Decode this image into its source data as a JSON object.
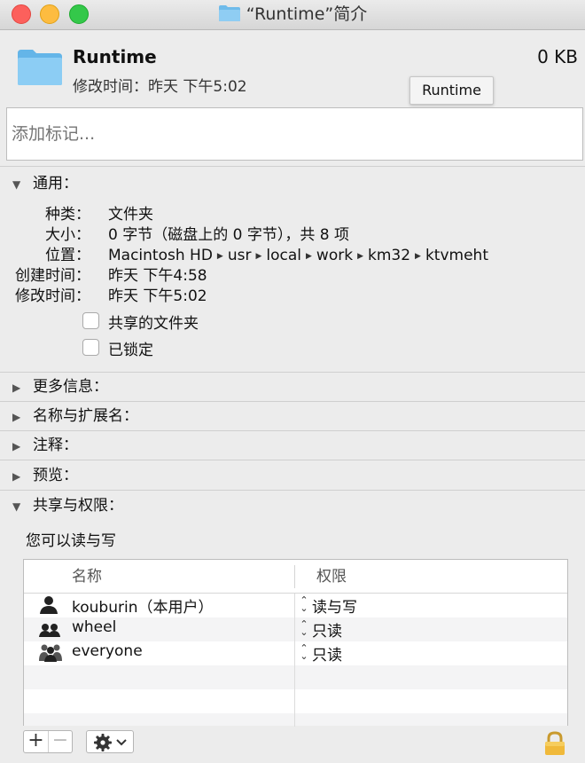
{
  "window": {
    "title": "“Runtime”简介"
  },
  "header": {
    "name": "Runtime",
    "size": "0 KB",
    "modified": "修改时间：昨天 下午5:02",
    "tooltip": "Runtime"
  },
  "tags": {
    "placeholder": "添加标记..."
  },
  "general": {
    "heading": "通用：",
    "kind_label": "种类：",
    "kind_value": "文件夹",
    "size_label": "大小：",
    "size_value": "0 字节（磁盘上的 0 字节），共 8 项",
    "where_label": "位置：",
    "path": [
      "Macintosh HD",
      "usr",
      "local",
      "work",
      "km32",
      "ktvmeht"
    ],
    "created_label": "创建时间：",
    "created_value": "昨天 下午4:58",
    "modified_label": "修改时间：",
    "modified_value": "昨天 下午5:02",
    "shared_folder": "共享的文件夹",
    "locked": "已锁定"
  },
  "sections": {
    "more_info": "更多信息：",
    "name_ext": "名称与扩展名：",
    "comments": "注释：",
    "preview": "预览：",
    "sharing": "共享与权限："
  },
  "sharing": {
    "note": "您可以读与写",
    "columns": {
      "name": "名称",
      "privilege": "权限"
    },
    "rows": [
      {
        "user": "kouburin（本用户）",
        "privilege": "读与写",
        "icon": "single-user-icon"
      },
      {
        "user": "wheel",
        "privilege": "只读",
        "icon": "group-icon"
      },
      {
        "user": "everyone",
        "privilege": "只读",
        "icon": "everyone-icon"
      }
    ]
  },
  "toolbar": {
    "add": "+",
    "remove": "−"
  },
  "colors": {
    "folder": "#7cc4f0",
    "close": "#fc605c",
    "minimize": "#fdbc40",
    "maximize": "#34c84a"
  }
}
